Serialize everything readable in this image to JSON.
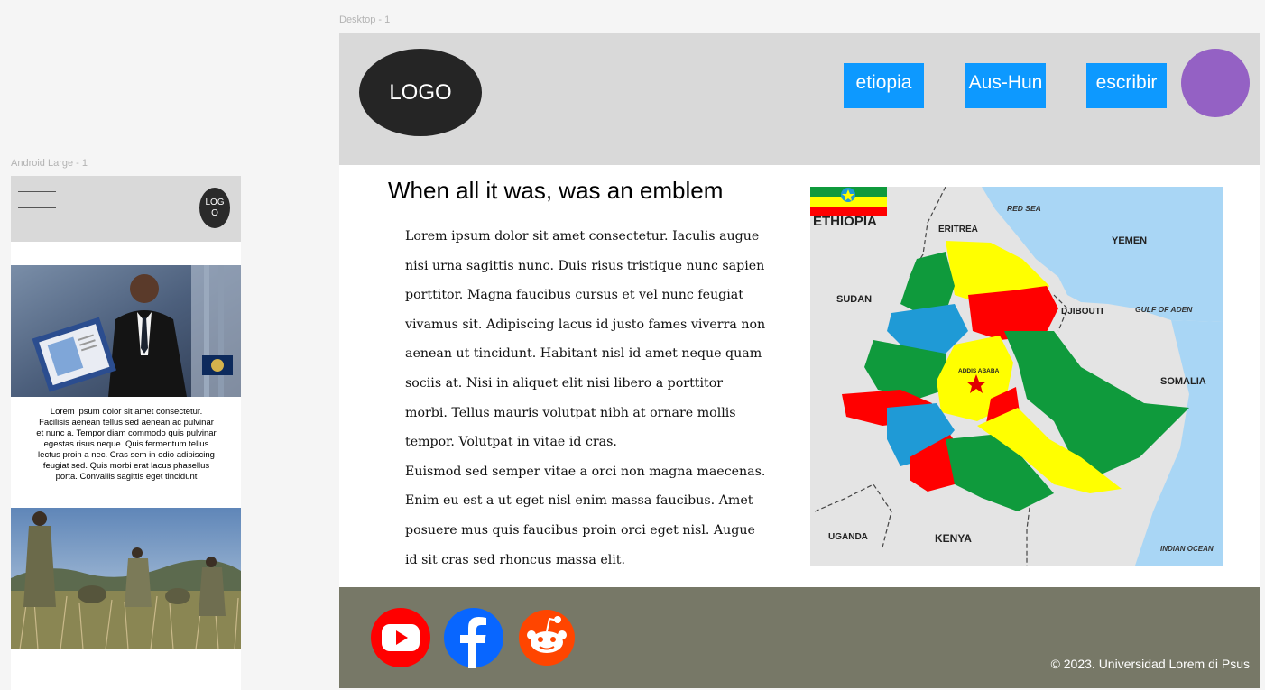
{
  "canvas": {
    "mobile_frame_label": "Android Large - 1",
    "desktop_frame_label": "Desktop - 1"
  },
  "mobile": {
    "menu_icon": "hamburger-icon",
    "logo_text": "LOGO",
    "paragraph": "Lorem ipsum dolor sit amet consectetur. Facilisis aenean tellus sed aenean ac pulvinar et nunc a. Tempor diam commodo quis pulvinar egestas risus neque. Quis fermentum tellus lectus proin a nec. Cras sem in odio adipiscing feugiat sed. Quis morbi erat lacus phasellus porta. Convallis sagittis eget tincidunt"
  },
  "desktop": {
    "header": {
      "logo_text": "LOGO",
      "nav": [
        {
          "label": "etiopia"
        },
        {
          "label": "Aus-Hun"
        },
        {
          "label": "escribir"
        }
      ],
      "avatar_color": "#9461c4",
      "nav_color": "#0d99ff"
    },
    "main": {
      "title": "When all it was, was an emblem",
      "paragraph_1": "Lorem ipsum dolor sit amet consectetur. Iaculis augue nisi urna sagittis nunc. Duis risus tristique nunc sapien porttitor. Magna faucibus cursus et vel nunc feugiat vivamus sit. Adipiscing lacus id justo fames viverra non aenean ut tincidunt. Habitant nisl id amet neque quam sociis at. Nisi in aliquet elit nisi libero a porttitor morbi. Tellus mauris volutpat nibh at ornare mollis tempor. Volutpat in vitae id cras.",
      "paragraph_2": "Euismod sed semper vitae a orci non magna maecenas. Enim eu est a ut eget nisl enim massa faucibus. Amet posuere mus quis faucibus proin orci eget nisl. Augue id sit cras sed rhoncus massa elit.",
      "map": {
        "title": "ETHIOPIA",
        "labels": {
          "eritrea": "ERITREA",
          "red_sea": "RED SEA",
          "yemen": "YEMEN",
          "sudan": "SUDAN",
          "djibouti": "DJIBOUTI",
          "gulf": "GULF OF ADEN",
          "capital": "ADDIS ABABA",
          "somalia": "SOMALIA",
          "uganda": "UGANDA",
          "kenya": "KENYA",
          "indian_ocean": "INDIAN OCEAN"
        },
        "region_colors": [
          "#0f9a3c",
          "#ffff00",
          "#ff0000",
          "#1f9ad6"
        ]
      }
    },
    "footer": {
      "social": [
        {
          "icon": "youtube-icon",
          "color": "#ff0000"
        },
        {
          "icon": "facebook-icon",
          "color": "#0866ff"
        },
        {
          "icon": "reddit-icon",
          "color": "#ff4500"
        }
      ],
      "copyright": "© 2023. Universidad Lorem di Psus"
    }
  }
}
